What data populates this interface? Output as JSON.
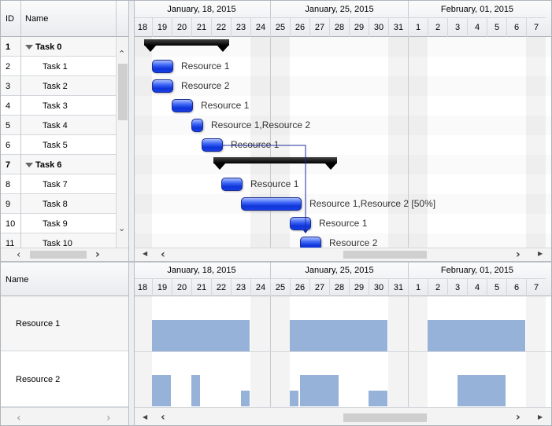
{
  "columns": {
    "id": "ID",
    "name": "Name"
  },
  "tasks": [
    {
      "id": "1",
      "name": "Task 0",
      "summary": true
    },
    {
      "id": "2",
      "name": "Task 1"
    },
    {
      "id": "3",
      "name": "Task 2"
    },
    {
      "id": "4",
      "name": "Task 3"
    },
    {
      "id": "5",
      "name": "Task 4"
    },
    {
      "id": "6",
      "name": "Task 5"
    },
    {
      "id": "7",
      "name": "Task 6",
      "summary": true
    },
    {
      "id": "8",
      "name": "Task 7"
    },
    {
      "id": "9",
      "name": "Task 8"
    },
    {
      "id": "10",
      "name": "Task 9"
    },
    {
      "id": "11",
      "name": "Task 10"
    }
  ],
  "timeline": {
    "weeks": [
      "January, 18, 2015",
      "January, 25, 2015",
      "February, 01, 2015"
    ],
    "days": [
      "18",
      "19",
      "20",
      "21",
      "22",
      "23",
      "24",
      "25",
      "26",
      "27",
      "28",
      "29",
      "30",
      "31",
      "1",
      "2",
      "3",
      "4",
      "5",
      "6",
      "7"
    ],
    "weekend_day_indices": [
      0,
      6,
      7,
      13,
      14,
      20
    ]
  },
  "bar_labels": [
    "Resource 1",
    "Resource 2",
    "Resource 1",
    "Resource 1,Resource 2",
    "Resource 1",
    "Resource 1",
    "Resource 1,Resource 2 [50%]",
    "Resource 1",
    "Resource 2"
  ],
  "resource_header": "Name",
  "resources": [
    {
      "name": "Resource 1"
    },
    {
      "name": "Resource 2"
    }
  ],
  "colors": {
    "task_bar": "#1a45e6",
    "summary_bar": "#000000",
    "load_bar": "#96b2d8",
    "dependency": "#1b2c9e",
    "weekend": "#f3f3f3"
  },
  "icons": {
    "expand": "triangle-down",
    "scroll_left": "chevron-left",
    "scroll_right": "chevron-right",
    "scroll_up": "chevron-up",
    "scroll_down": "chevron-down"
  }
}
